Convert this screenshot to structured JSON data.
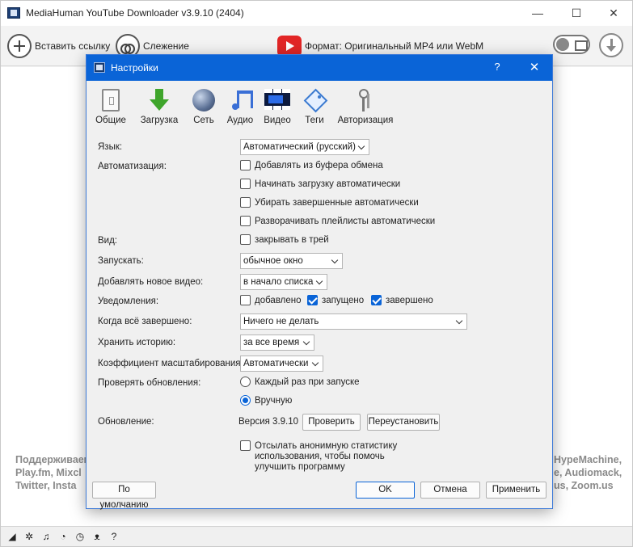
{
  "app": {
    "title": "MediaHuman YouTube Downloader v3.9.10 (2404)",
    "window_controls": {
      "minimize": "—",
      "maximize": "☐",
      "close": "✕"
    }
  },
  "toolbar": {
    "paste_link": "Вставить ссылку",
    "tracking": "Слежение",
    "format": "Формат: Оригинальный MP4 или WebM"
  },
  "supported_text": {
    "left_line1": "Поддерживаем",
    "left_line2": "Play.fm, Mixcl",
    "left_line3": "Twitter, Insta",
    "right_line1": "HypeMachine,",
    "right_line2": "e, Audiomack,",
    "right_line3": "us, Zoom.us"
  },
  "statusbar": {
    "icons": [
      "brush-icon",
      "gear-icon",
      "music-icon",
      "snail-icon",
      "clock-icon",
      "binoculars-icon",
      "help-icon"
    ],
    "glyphs": [
      "◢",
      "✲",
      "♫",
      "◔",
      "◷",
      "ᴥ",
      "?"
    ]
  },
  "dialog": {
    "title": "Настройки",
    "help": "?",
    "close": "✕",
    "tabs": [
      "Общие",
      "Загрузка",
      "Сеть",
      "Аудио",
      "Видео",
      "Теги",
      "Авторизация"
    ],
    "language": {
      "label": "Язык:",
      "value": "Автоматический (русский)"
    },
    "automation": {
      "label": "Автоматизация:",
      "options": [
        {
          "text": "Добавлять из буфера обмена",
          "checked": false
        },
        {
          "text": "Начинать загрузку автоматически",
          "checked": false
        },
        {
          "text": "Убирать завершенные автоматически",
          "checked": false
        },
        {
          "text": "Разворачивать плейлисты автоматически",
          "checked": false
        }
      ]
    },
    "view": {
      "label": "Вид:",
      "option": "закрывать в трей",
      "checked": false
    },
    "launch": {
      "label": "Запускать:",
      "value": "обычное окно"
    },
    "add_video": {
      "label": "Добавлять новое видео:",
      "value": "в начало списка"
    },
    "notifications": {
      "label": "Уведомления:",
      "added": "добавлено",
      "started": "запущено",
      "finished": "завершено",
      "added_checked": false,
      "started_checked": true,
      "finished_checked": true
    },
    "when_done": {
      "label": "Когда всё завершено:",
      "value": "Ничего не делать"
    },
    "history": {
      "label": "Хранить историю:",
      "value": "за все время"
    },
    "scale": {
      "label": "Коэффициент масштабирования:",
      "value": "Автоматически"
    },
    "check_updates": {
      "label": "Проверять обновления:",
      "option1": "Каждый раз при запуске",
      "option2": "Вручную",
      "selected": "Вручную"
    },
    "update": {
      "label": "Обновление:",
      "version": "Версия 3.9.10",
      "check_button": "Проверить",
      "reinstall_button": "Переустановить"
    },
    "stats": {
      "line1": "Отсылать анонимную статистику",
      "line2": "использования, чтобы помочь",
      "line3": "улучшить программу",
      "checked": false
    },
    "buttons": {
      "defaults": "По умолчанию",
      "ok": "OK",
      "cancel": "Отмена",
      "apply": "Применить"
    }
  },
  "colors": {
    "accent": "#0a64d7",
    "youtube_red": "#e22626",
    "supported_text": "#8a8a8a"
  }
}
